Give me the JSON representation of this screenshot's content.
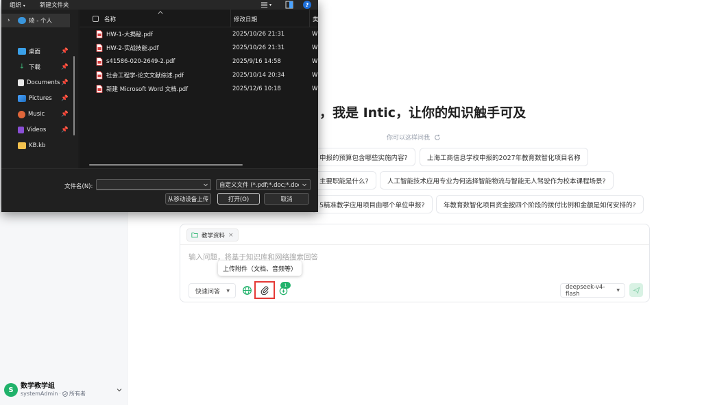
{
  "colors": {
    "brand_green": "#21b26b",
    "dialog_bg": "#1c1c1c",
    "pdf_red": "#d83b3b",
    "highlight_red": "#e53935",
    "help_blue": "#1e6fd9"
  },
  "sidebar": {
    "user": {
      "avatar_letter": "S",
      "name": "数学教学组",
      "account": "systemAdmin",
      "separator": "·",
      "role": "所有者"
    }
  },
  "main": {
    "hero_title": "，我是 Intic，让你的知识触手可及",
    "suggest_hint": "你可以这样问我",
    "suggestions": [
      "申报的预算包含哪些实施内容?",
      "上海工商信息学校申报的2027年教育数智化项目名称",
      "主要职能是什么?",
      "人工智能技术应用专业为何选择智能物流与智能无人驾驶作为校本课程场景?",
      "5精准教学应用项目由哪个单位申报?",
      "年教育数智化项目资金按四个阶段的拨付比例和金额是如何安排的?"
    ],
    "chat": {
      "kb_tab_label": "教学资料",
      "kb_tab_close": "×",
      "placeholder": "输入问题，将基于知识库和网络搜索回答",
      "mode_label": "快速问答",
      "plugin_badge": "1",
      "model_label": "deepseek-v4-flash",
      "attach_tooltip": "上传附件（文档、音频等）"
    }
  },
  "dialog": {
    "toolbar": {
      "organize": "组织",
      "new_folder": "新建文件夹",
      "help": "?"
    },
    "nav": [
      {
        "label": "琦 - 个人",
        "icon": "onedrive-icon",
        "pinned": false
      },
      {
        "label": "桌面",
        "icon": "desktop-icon",
        "pinned": true
      },
      {
        "label": "下载",
        "icon": "download-icon",
        "pinned": true
      },
      {
        "label": "Documents",
        "icon": "documents-icon",
        "pinned": true
      },
      {
        "label": "Pictures",
        "icon": "pictures-icon",
        "pinned": true
      },
      {
        "label": "Music",
        "icon": "music-icon",
        "pinned": true
      },
      {
        "label": "Videos",
        "icon": "videos-icon",
        "pinned": true
      },
      {
        "label": "KB.kb",
        "icon": "folder-icon",
        "pinned": false
      }
    ],
    "columns": {
      "name": "名称",
      "date": "修改日期",
      "type": "类"
    },
    "files": [
      {
        "name": "HW-1-大揭秘.pdf",
        "date": "2025/10/26 21:31",
        "type": "W"
      },
      {
        "name": "HW-2-实战技能.pdf",
        "date": "2025/10/26 21:31",
        "type": "W"
      },
      {
        "name": "s41586-020-2649-2.pdf",
        "date": "2025/9/16 14:58",
        "type": "W"
      },
      {
        "name": "社会工程学-论文文献综述.pdf",
        "date": "2025/10/14 20:34",
        "type": "W"
      },
      {
        "name": "新建 Microsoft Word 文档.pdf",
        "date": "2025/12/6 10:18",
        "type": "W"
      }
    ],
    "bottom": {
      "filename_label": "文件名(N):",
      "filename_value": "",
      "filetype": "自定义文件 (*.pdf;*.doc;*.docx",
      "mobile_upload": "从移动设备上传",
      "open": "打开(O)",
      "cancel": "取消"
    }
  }
}
